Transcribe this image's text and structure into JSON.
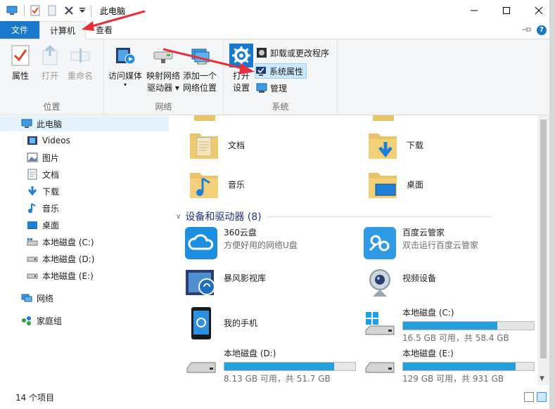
{
  "window": {
    "title": "此电脑"
  },
  "tabs": [
    {
      "label": "文件"
    },
    {
      "label": "计算机"
    },
    {
      "label": "查看"
    }
  ],
  "ribbon": {
    "groups": {
      "location": "位置",
      "network": "网络",
      "system": "系统"
    },
    "buttons": {
      "properties": "属性",
      "open": "打开",
      "rename": "重命名",
      "access_media": "访问媒体",
      "map_drive_l1": "映射网络",
      "map_drive_l2": "驱动器",
      "add_location_l1": "添加一个",
      "add_location_l2": "网络位置",
      "open_settings_l1": "打开",
      "open_settings_l2": "设置",
      "uninstall": "卸载或更改程序",
      "system_properties": "系统属性",
      "manage": "管理"
    }
  },
  "nav": {
    "items": [
      {
        "label": "此电脑"
      },
      {
        "label": "Videos"
      },
      {
        "label": "图片"
      },
      {
        "label": "文档"
      },
      {
        "label": "下载"
      },
      {
        "label": "音乐"
      },
      {
        "label": "桌面"
      },
      {
        "label": "本地磁盘 (C:)"
      },
      {
        "label": "本地磁盘 (D:)"
      },
      {
        "label": "本地磁盘 (E:)"
      },
      {
        "label": "网络"
      },
      {
        "label": "家庭组"
      }
    ]
  },
  "folders": [
    {
      "label": "文档"
    },
    {
      "label": "下载"
    },
    {
      "label": "音乐"
    },
    {
      "label": "桌面"
    }
  ],
  "devices_section": {
    "title": "设备和驱动器 (8)"
  },
  "devices": [
    {
      "name": "360云盘",
      "sub": "方便好用的网络U盘"
    },
    {
      "name": "百度云管家",
      "sub": "双击运行百度云管家"
    },
    {
      "name": "暴风影视库"
    },
    {
      "name": "视频设备"
    },
    {
      "name": "我的手机"
    },
    {
      "name": "本地磁盘 (C:)",
      "free": "16.5 GB 可用，共 58.4 GB",
      "used_fraction": 0.72
    },
    {
      "name": "本地磁盘 (D:)",
      "free": "8.13 GB 可用，共 51.7 GB",
      "used_fraction": 0.84
    },
    {
      "name": "本地磁盘 (E:)",
      "free": "129 GB 可用，共 931 GB",
      "used_fraction": 0.86
    }
  ],
  "status": {
    "count": "14 个项目"
  },
  "colors": {
    "accent": "#1979ca",
    "bar_fill": "#26a0da",
    "annotation_arrow": "#e8303a"
  }
}
